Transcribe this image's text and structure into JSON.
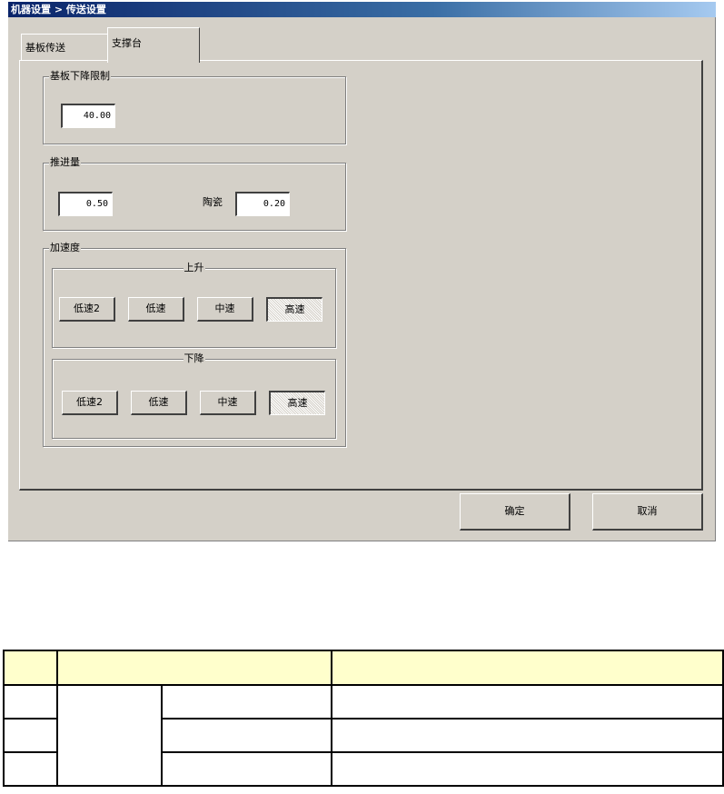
{
  "window": {
    "title": "机器设置 > 传送设置",
    "tabs": [
      {
        "label": "基板传送"
      },
      {
        "label": "支撑台"
      }
    ]
  },
  "substrate_lower_limit": {
    "title": "基板下降限制",
    "value": "40.00"
  },
  "push_amount": {
    "title": "推进量",
    "value": "0.50",
    "ceramic_label": "陶瓷",
    "ceramic_value": "0.20"
  },
  "acceleration": {
    "title": "加速度",
    "rise": {
      "title": "上升",
      "buttons": [
        "低速2",
        "低速",
        "中速",
        "高速"
      ],
      "selected": "高速"
    },
    "fall": {
      "title": "下降",
      "buttons": [
        "低速2",
        "低速",
        "中速",
        "高速"
      ],
      "selected": "高速"
    }
  },
  "footer": {
    "ok_label": "确定",
    "cancel_label": "取消"
  },
  "colors": {
    "dialog_bg": "#d4d0c8",
    "title_bar": "#0a246a",
    "table_header": "#ffffcc"
  }
}
